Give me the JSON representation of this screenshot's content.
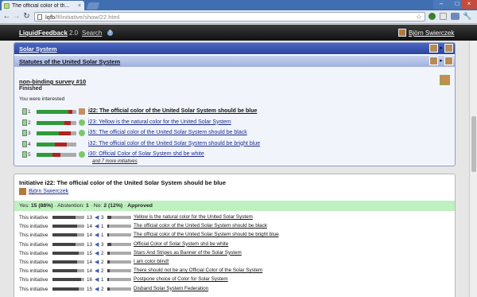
{
  "browser": {
    "tab_title": "The official color of th...",
    "tab_close": "×",
    "url_host": "lqfb",
    "url_path": "/lf/initiative/show/22.html",
    "window_controls": {
      "minimize": "–",
      "maximize": "□",
      "close": "×"
    },
    "nav": {
      "back": "←",
      "forward": "→",
      "reload": "↻"
    },
    "star": "☆",
    "wrench": "🔧"
  },
  "header": {
    "brand": "LiquidFeedback",
    "version": "2.0",
    "search": "Search",
    "help": "?",
    "user_name": "Björn Swierczek"
  },
  "issue": {
    "area": "Solar System",
    "policy": "Statutes of the United Solar System",
    "title": "non-binding survey #10",
    "state": "Finished",
    "interest_note": "You were interested",
    "arrow": "▸",
    "initiatives": [
      {
        "rank": "1",
        "yes": 0.8,
        "no": 0.1,
        "hand": "person",
        "label": "i22: The official color of the United Solar System should be blue"
      },
      {
        "rank": "2",
        "yes": 0.7,
        "no": 0.15,
        "hand": "thumb",
        "label": "i23: Yellow is the natural color for the United Solar System"
      },
      {
        "rank": "3",
        "yes": 0.55,
        "no": 0.3,
        "hand": "thumb",
        "label": "i35: The official color of the United Solar System should be black"
      },
      {
        "rank": "4",
        "yes": 0.45,
        "no": 0.3,
        "hand": "none",
        "label": "i32: The official color of the United Solar System should be bright blue"
      },
      {
        "rank": "5",
        "yes": 0.4,
        "no": 0.2,
        "hand": "thumb",
        "label": "i30: Official Color of Solar System shd be white"
      }
    ],
    "more": "and 7 more initiatives"
  },
  "initiative": {
    "heading": "Initiative i22: The official color of the United Solar System should be blue",
    "author": "Björn Swierczek",
    "result": {
      "yes_label": "Yes:",
      "yes_value": "15 (88%)",
      "abstention_label": "Abstention:",
      "abstention_value": "1",
      "no_label": "No:",
      "no_value": "2 (12%)",
      "status": "Approved"
    },
    "comparisons": [
      {
        "label": "This initiative",
        "n1": "13",
        "n2": "3",
        "name": "Yellow is the natural color for the United Solar System"
      },
      {
        "label": "This initiative",
        "n1": "14",
        "n2": "1",
        "name": "The official color of the United Solar System should be black"
      },
      {
        "label": "This initiative",
        "n1": "14",
        "n2": "1",
        "name": "The official color of the United Solar System should be bright blue"
      },
      {
        "label": "This initiative",
        "n1": "13",
        "n2": "3",
        "name": "Official Color of Solar System shd be white"
      },
      {
        "label": "This initiative",
        "n1": "15",
        "n2": "2",
        "name": "Stars And Stripes as Banner of the Solar System"
      },
      {
        "label": "This initiative",
        "n1": "14",
        "n2": "2",
        "name": "I am color blind!"
      },
      {
        "label": "This initiative",
        "n1": "14",
        "n2": "2",
        "name": "There should not be any Official Color of the Solar System"
      },
      {
        "label": "This initiative",
        "n1": "16",
        "n2": "1",
        "name": "Postpone choice of Color for Solar System"
      },
      {
        "label": "This initiative",
        "n1": "15",
        "n2": "2",
        "name": "Disband Solar System Federation"
      }
    ]
  }
}
